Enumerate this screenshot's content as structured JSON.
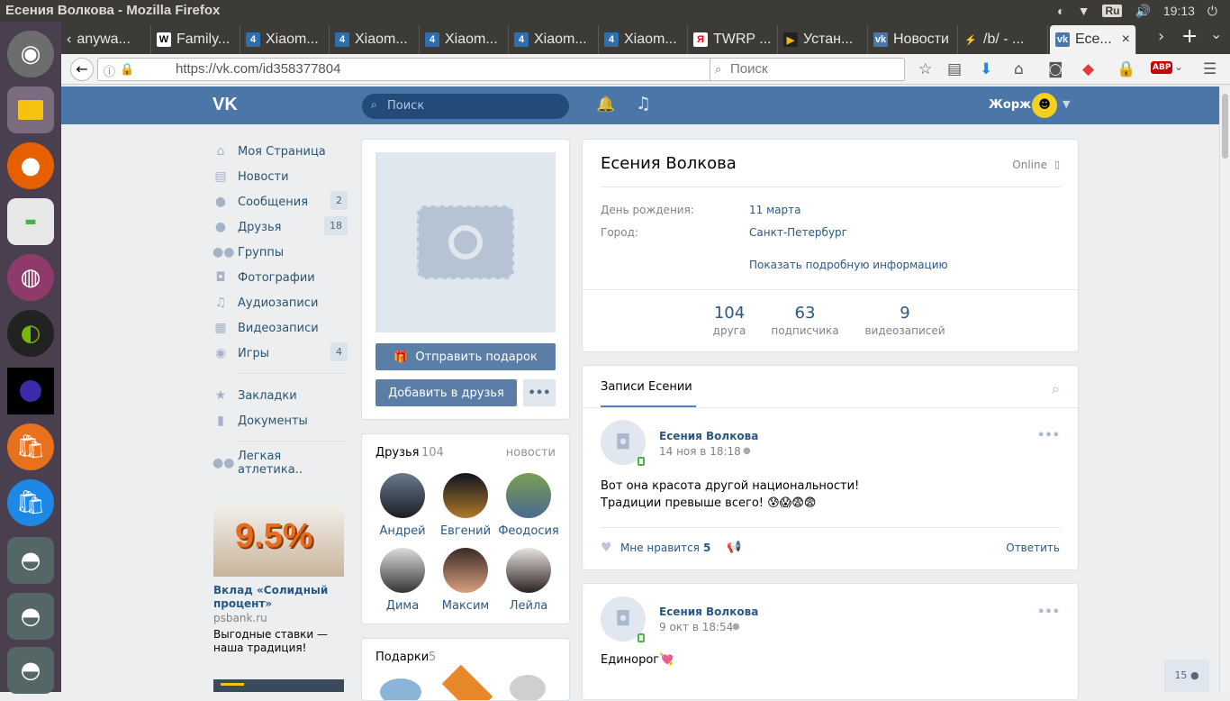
{
  "system": {
    "title": "Есения Волкова - Mozilla Firefox",
    "lang": "Ru",
    "time": "19:13"
  },
  "tabs": [
    {
      "label": "anywa...",
      "icon": "chevron"
    },
    {
      "label": "Family...",
      "icon": "wiki"
    },
    {
      "label": "Xiaom...",
      "icon": "4pda"
    },
    {
      "label": "Xiaom...",
      "icon": "4pda"
    },
    {
      "label": "Xiaom...",
      "icon": "4pda"
    },
    {
      "label": "Xiaom...",
      "icon": "4pda"
    },
    {
      "label": "Xiaom...",
      "icon": "4pda"
    },
    {
      "label": "TWRP ...",
      "icon": "yandex"
    },
    {
      "label": "Устан...",
      "icon": "play"
    },
    {
      "label": "Новости",
      "icon": "vk"
    },
    {
      "label": "/b/ - ...",
      "icon": "bolt"
    },
    {
      "label": "Есе...",
      "icon": "vk",
      "active": true
    }
  ],
  "browser": {
    "url": "https://vk.com/id358377804",
    "search_placeholder": "Поиск"
  },
  "vk": {
    "search_placeholder": "Поиск",
    "user_name": "Жорж",
    "menu": [
      {
        "label": "Моя Страница",
        "icon": "home-icon"
      },
      {
        "label": "Новости",
        "icon": "news-icon"
      },
      {
        "label": "Сообщения",
        "icon": "messages-icon",
        "count": "2"
      },
      {
        "label": "Друзья",
        "icon": "friends-icon",
        "count": "18"
      },
      {
        "label": "Группы",
        "icon": "groups-icon"
      },
      {
        "label": "Фотографии",
        "icon": "photos-icon"
      },
      {
        "label": "Аудиозаписи",
        "icon": "audio-icon"
      },
      {
        "label": "Видеозаписи",
        "icon": "video-icon"
      },
      {
        "label": "Игры",
        "icon": "games-icon",
        "count": "4"
      }
    ],
    "menu2": [
      {
        "label": "Закладки",
        "icon": "bookmarks-icon"
      },
      {
        "label": "Документы",
        "icon": "documents-icon"
      }
    ],
    "menu3": [
      {
        "label": "Легкая атлетика..",
        "icon": "group-icon"
      }
    ],
    "ad": {
      "banner_text": "9.5%",
      "title": "Вклад «Солидный процент»",
      "domain": "psbank.ru",
      "text": "Выгодные ставки — наша традиция!"
    },
    "profile": {
      "send_gift": "Отправить подарок",
      "add_friend": "Добавить в друзья",
      "name": "Есения Волкова",
      "status": "Online",
      "birthday_label": "День рождения:",
      "birthday": "11 марта",
      "city_label": "Город:",
      "city": "Санкт-Петербург",
      "more_info": "Показать подробную информацию",
      "counters": [
        {
          "value": "104",
          "label": "друга"
        },
        {
          "value": "63",
          "label": "подписчика"
        },
        {
          "value": "9",
          "label": "видеозаписей"
        }
      ]
    },
    "friends": {
      "title": "Друзья",
      "count": "104",
      "link": "новости",
      "items": [
        "Андрей",
        "Евгений",
        "Феодосия",
        "Дима",
        "Максим",
        "Лейла"
      ]
    },
    "gifts": {
      "title": "Подарки",
      "count": "5"
    },
    "wall": {
      "tab": "Записи Есении",
      "posts": [
        {
          "author": "Есения Волкова",
          "date": "14 ноя в 18:18",
          "line1": "Вот она красота другой национальности!",
          "line2": "Традиции превыше всего! 😰😱😨😨",
          "likes_label": "Мне нравится",
          "likes": "5",
          "reply": "Ответить"
        },
        {
          "author": "Есения Волкова",
          "date": "9 окт в 18:54",
          "line1": "Единорог💘"
        }
      ]
    },
    "online_count": "15"
  }
}
